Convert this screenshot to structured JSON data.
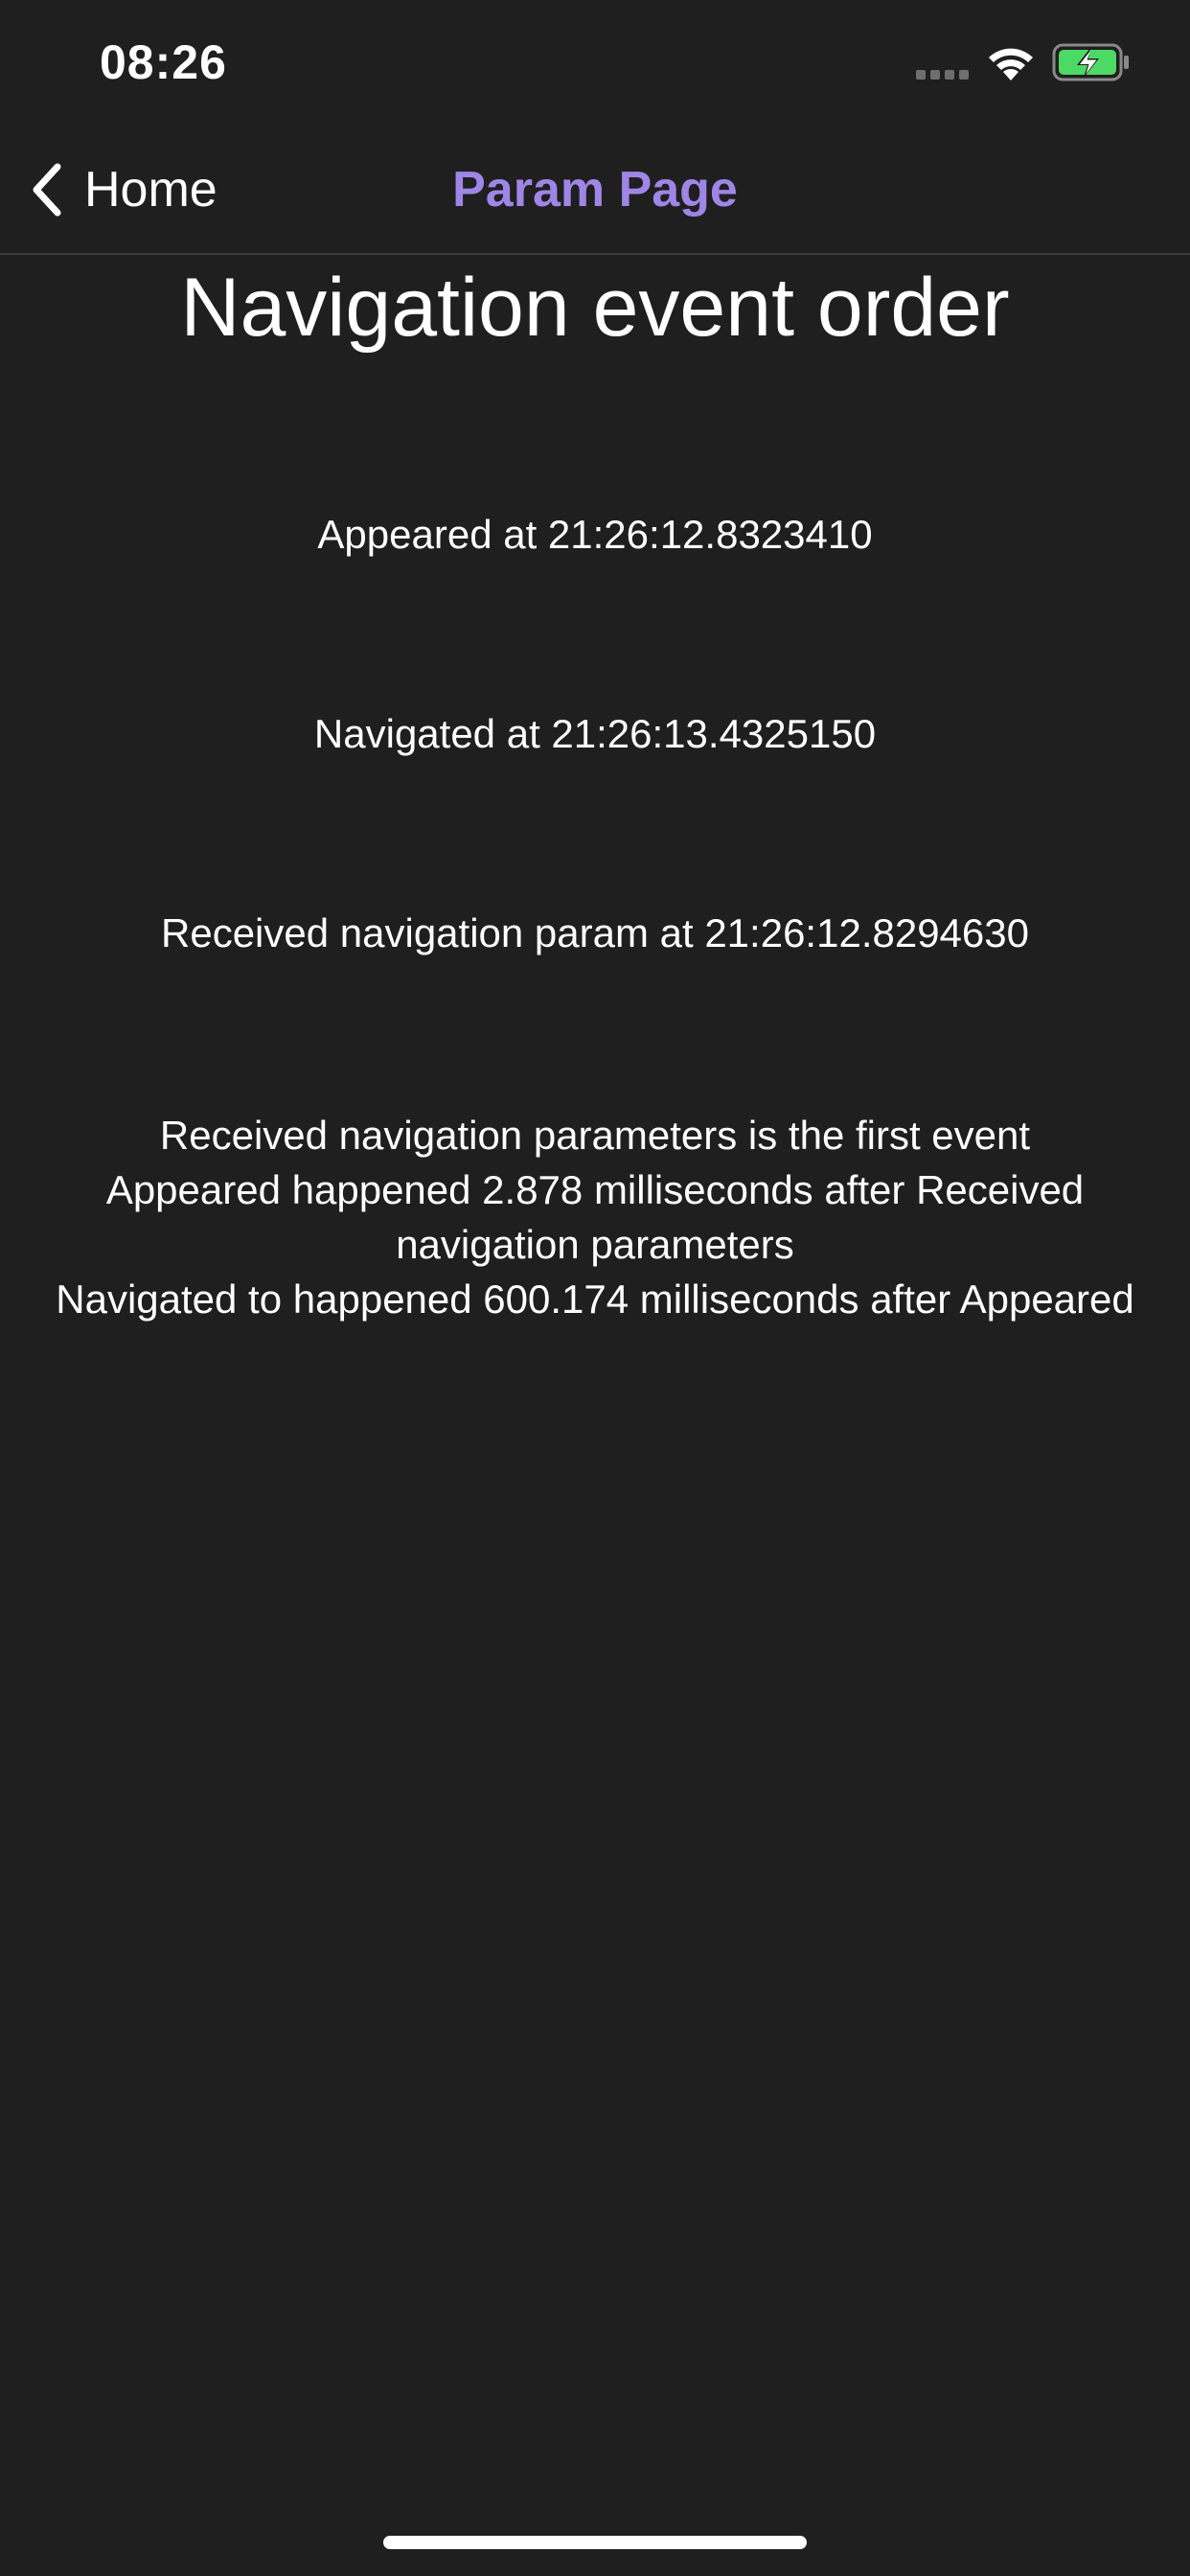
{
  "status_bar": {
    "time": "08:26",
    "icons": [
      "signal-dots-icon",
      "wifi-icon",
      "battery-charging-icon"
    ],
    "battery_color": "#4cd964"
  },
  "nav_bar": {
    "back_label": "Home",
    "title": "Param Page",
    "title_color": "#9f86e6"
  },
  "content": {
    "heading": "Navigation event order",
    "events": {
      "appeared": "Appeared at 21:26:12.8323410",
      "navigated": "Navigated at 21:26:13.4325150",
      "received": "Received navigation param at 21:26:12.8294630"
    },
    "summary": {
      "line1": "Received navigation parameters is the first event",
      "line2": "Appeared happened 2.878 milliseconds after Received navigation parameters",
      "line3": "Navigated to happened 600.174 milliseconds after Appeared"
    }
  }
}
